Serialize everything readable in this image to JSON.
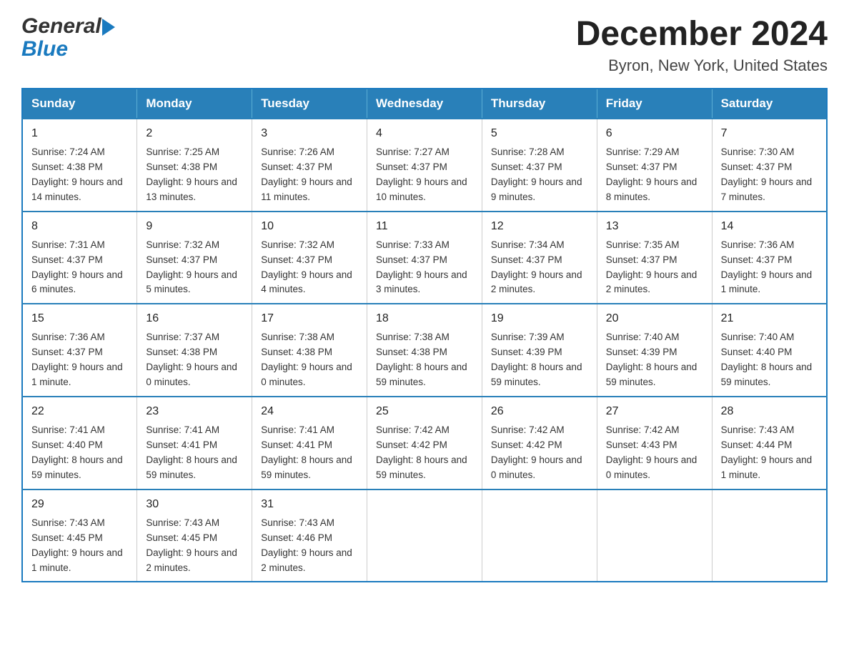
{
  "header": {
    "logo_general": "General",
    "logo_blue": "Blue",
    "main_title": "December 2024",
    "subtitle": "Byron, New York, United States"
  },
  "calendar": {
    "days_of_week": [
      "Sunday",
      "Monday",
      "Tuesday",
      "Wednesday",
      "Thursday",
      "Friday",
      "Saturday"
    ],
    "weeks": [
      [
        {
          "day": "1",
          "sunrise": "7:24 AM",
          "sunset": "4:38 PM",
          "daylight": "9 hours and 14 minutes."
        },
        {
          "day": "2",
          "sunrise": "7:25 AM",
          "sunset": "4:38 PM",
          "daylight": "9 hours and 13 minutes."
        },
        {
          "day": "3",
          "sunrise": "7:26 AM",
          "sunset": "4:37 PM",
          "daylight": "9 hours and 11 minutes."
        },
        {
          "day": "4",
          "sunrise": "7:27 AM",
          "sunset": "4:37 PM",
          "daylight": "9 hours and 10 minutes."
        },
        {
          "day": "5",
          "sunrise": "7:28 AM",
          "sunset": "4:37 PM",
          "daylight": "9 hours and 9 minutes."
        },
        {
          "day": "6",
          "sunrise": "7:29 AM",
          "sunset": "4:37 PM",
          "daylight": "9 hours and 8 minutes."
        },
        {
          "day": "7",
          "sunrise": "7:30 AM",
          "sunset": "4:37 PM",
          "daylight": "9 hours and 7 minutes."
        }
      ],
      [
        {
          "day": "8",
          "sunrise": "7:31 AM",
          "sunset": "4:37 PM",
          "daylight": "9 hours and 6 minutes."
        },
        {
          "day": "9",
          "sunrise": "7:32 AM",
          "sunset": "4:37 PM",
          "daylight": "9 hours and 5 minutes."
        },
        {
          "day": "10",
          "sunrise": "7:32 AM",
          "sunset": "4:37 PM",
          "daylight": "9 hours and 4 minutes."
        },
        {
          "day": "11",
          "sunrise": "7:33 AM",
          "sunset": "4:37 PM",
          "daylight": "9 hours and 3 minutes."
        },
        {
          "day": "12",
          "sunrise": "7:34 AM",
          "sunset": "4:37 PM",
          "daylight": "9 hours and 2 minutes."
        },
        {
          "day": "13",
          "sunrise": "7:35 AM",
          "sunset": "4:37 PM",
          "daylight": "9 hours and 2 minutes."
        },
        {
          "day": "14",
          "sunrise": "7:36 AM",
          "sunset": "4:37 PM",
          "daylight": "9 hours and 1 minute."
        }
      ],
      [
        {
          "day": "15",
          "sunrise": "7:36 AM",
          "sunset": "4:37 PM",
          "daylight": "9 hours and 1 minute."
        },
        {
          "day": "16",
          "sunrise": "7:37 AM",
          "sunset": "4:38 PM",
          "daylight": "9 hours and 0 minutes."
        },
        {
          "day": "17",
          "sunrise": "7:38 AM",
          "sunset": "4:38 PM",
          "daylight": "9 hours and 0 minutes."
        },
        {
          "day": "18",
          "sunrise": "7:38 AM",
          "sunset": "4:38 PM",
          "daylight": "8 hours and 59 minutes."
        },
        {
          "day": "19",
          "sunrise": "7:39 AM",
          "sunset": "4:39 PM",
          "daylight": "8 hours and 59 minutes."
        },
        {
          "day": "20",
          "sunrise": "7:40 AM",
          "sunset": "4:39 PM",
          "daylight": "8 hours and 59 minutes."
        },
        {
          "day": "21",
          "sunrise": "7:40 AM",
          "sunset": "4:40 PM",
          "daylight": "8 hours and 59 minutes."
        }
      ],
      [
        {
          "day": "22",
          "sunrise": "7:41 AM",
          "sunset": "4:40 PM",
          "daylight": "8 hours and 59 minutes."
        },
        {
          "day": "23",
          "sunrise": "7:41 AM",
          "sunset": "4:41 PM",
          "daylight": "8 hours and 59 minutes."
        },
        {
          "day": "24",
          "sunrise": "7:41 AM",
          "sunset": "4:41 PM",
          "daylight": "8 hours and 59 minutes."
        },
        {
          "day": "25",
          "sunrise": "7:42 AM",
          "sunset": "4:42 PM",
          "daylight": "8 hours and 59 minutes."
        },
        {
          "day": "26",
          "sunrise": "7:42 AM",
          "sunset": "4:42 PM",
          "daylight": "9 hours and 0 minutes."
        },
        {
          "day": "27",
          "sunrise": "7:42 AM",
          "sunset": "4:43 PM",
          "daylight": "9 hours and 0 minutes."
        },
        {
          "day": "28",
          "sunrise": "7:43 AM",
          "sunset": "4:44 PM",
          "daylight": "9 hours and 1 minute."
        }
      ],
      [
        {
          "day": "29",
          "sunrise": "7:43 AM",
          "sunset": "4:45 PM",
          "daylight": "9 hours and 1 minute."
        },
        {
          "day": "30",
          "sunrise": "7:43 AM",
          "sunset": "4:45 PM",
          "daylight": "9 hours and 2 minutes."
        },
        {
          "day": "31",
          "sunrise": "7:43 AM",
          "sunset": "4:46 PM",
          "daylight": "9 hours and 2 minutes."
        },
        null,
        null,
        null,
        null
      ]
    ]
  }
}
